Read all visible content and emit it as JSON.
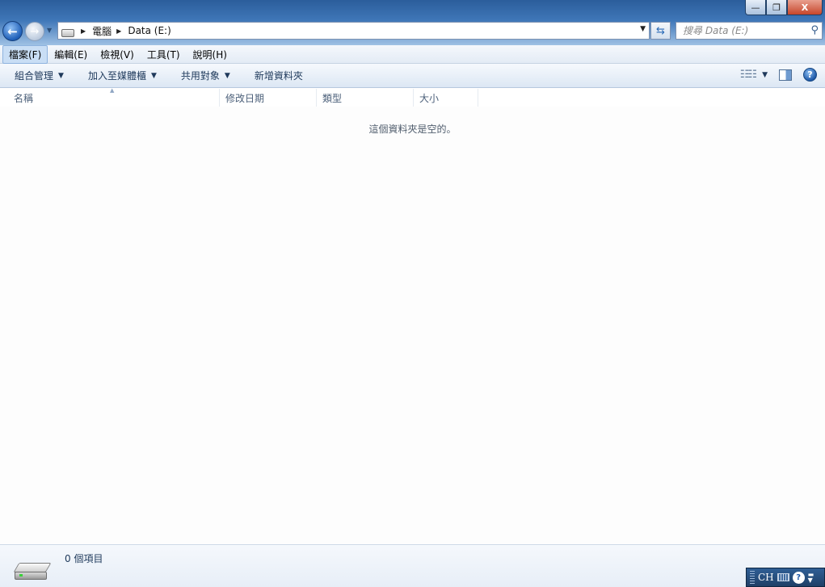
{
  "window": {
    "minimize_glyph": "—",
    "maximize_glyph": "❐",
    "close_glyph": "X"
  },
  "nav": {
    "back_glyph": "←",
    "forward_glyph": "→"
  },
  "address": {
    "crumbs": [
      "電腦",
      "Data (E:)"
    ]
  },
  "search": {
    "placeholder": "搜尋 Data (E:)"
  },
  "menu": {
    "items": [
      "檔案(F)",
      "編輯(E)",
      "檢視(V)",
      "工具(T)",
      "說明(H)"
    ]
  },
  "commands": {
    "organize": "組合管理",
    "include_library": "加入至媒體櫃",
    "share_with": "共用對象",
    "new_folder": "新增資料夾"
  },
  "columns": {
    "name": "名稱",
    "date_modified": "修改日期",
    "type": "類型",
    "size": "大小"
  },
  "content": {
    "empty_message": "這個資料夾是空的。"
  },
  "details": {
    "item_count": "0 個項目"
  },
  "langbar": {
    "language": "CH",
    "help": "?"
  }
}
